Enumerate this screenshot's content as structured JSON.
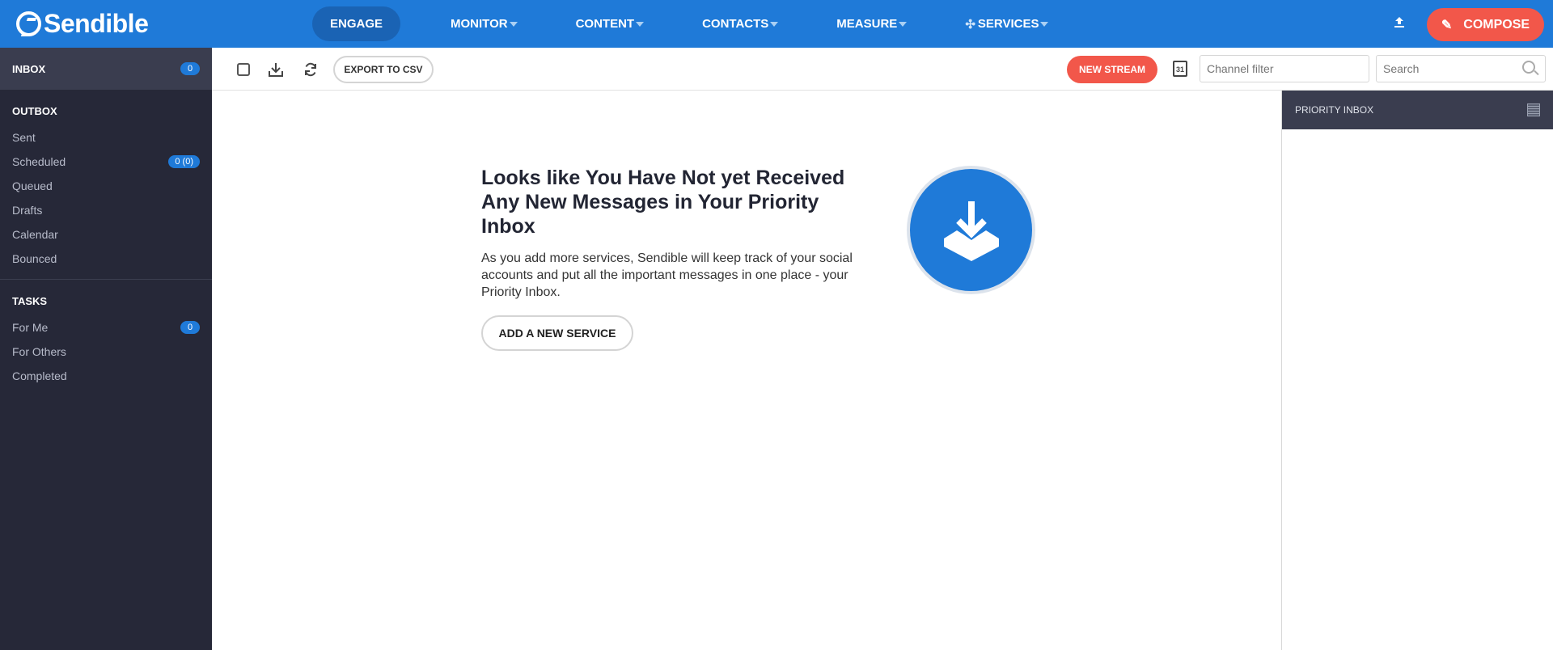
{
  "brand": {
    "name": "Sendible"
  },
  "nav": {
    "items": [
      {
        "label": "ENGAGE",
        "active": true
      },
      {
        "label": "MONITOR",
        "dropdown": true
      },
      {
        "label": "CONTENT",
        "dropdown": true
      },
      {
        "label": "CONTACTS",
        "dropdown": true
      },
      {
        "label": "MEASURE",
        "dropdown": true
      },
      {
        "label": "SERVICES",
        "dropdown": true
      }
    ],
    "compose_label": "COMPOSE",
    "upload_icon": "upload-icon"
  },
  "sidebar": {
    "inbox": {
      "label": "INBOX",
      "count": "0"
    },
    "outbox": {
      "title": "OUTBOX",
      "items": [
        {
          "label": "Sent",
          "badge": ""
        },
        {
          "label": "Scheduled",
          "badge": "0 (0)"
        },
        {
          "label": "Queued",
          "badge": ""
        },
        {
          "label": "Drafts",
          "badge": ""
        },
        {
          "label": "Calendar",
          "badge": ""
        },
        {
          "label": "Bounced",
          "badge": ""
        }
      ]
    },
    "tasks": {
      "title": "TASKS",
      "items": [
        {
          "label": "For Me",
          "badge": "0"
        },
        {
          "label": "For Others",
          "badge": ""
        },
        {
          "label": "Completed",
          "badge": ""
        }
      ]
    }
  },
  "toolbar": {
    "export_label": "EXPORT TO CSV",
    "new_stream_label": "NEW STREAM",
    "calendar_day": "31",
    "channel_filter_placeholder": "Channel filter",
    "search_placeholder": "Search"
  },
  "empty_state": {
    "title": "Looks like You Have Not yet Received Any New Messages in Your Priority Inbox",
    "text": "As you add more services, Sendible will keep track of your social accounts and put all the important messages in one place - your Priority Inbox.",
    "button_label": "ADD A NEW SERVICE"
  },
  "right_panel": {
    "title": "PRIORITY INBOX"
  },
  "colors": {
    "brand_blue": "#1f7ad8",
    "accent_red": "#f2574a",
    "sidebar_bg": "#262838"
  }
}
